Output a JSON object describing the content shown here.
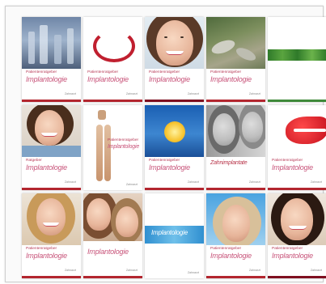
{
  "cards": [
    {
      "line1": "Patientenratgeber",
      "line2": "Implantologie",
      "line3": "",
      "logo": "Zahnarzt"
    },
    {
      "line1": "Patientenratgeber",
      "line2": "Implantologie",
      "line3": "",
      "logo": "Zahnarzt"
    },
    {
      "line1": "Patientenratgeber",
      "line2": "Implantologie",
      "line3": "",
      "logo": "Zahnarzt"
    },
    {
      "line1": "Patientenratgeber",
      "line2": "Implantologie",
      "line3": "",
      "logo": "Zahnarzt"
    },
    {
      "line1": "",
      "line2": "",
      "line3": "",
      "logo": ""
    },
    {
      "line1": "Ratgeber",
      "line2": "Implantologie",
      "line3": "",
      "logo": "Zahnarzt"
    },
    {
      "line1": "Patientenratgeber",
      "line2": "Implantologie",
      "line3": "",
      "logo": "Zahnarzt"
    },
    {
      "line1": "Patientenratgeber",
      "line2": "Implantologie",
      "line3": "",
      "logo": "Zahnarzt"
    },
    {
      "line1": "",
      "line2": "Zahnimplantate",
      "line3": "",
      "logo": "Zahnarzt"
    },
    {
      "line1": "Patientenratgeber",
      "line2": "Implantologie",
      "line3": "",
      "logo": "Zahnarzt"
    },
    {
      "line1": "Patientenratgeber",
      "line2": "Implantologie",
      "line3": "",
      "logo": "Zahnarzt"
    },
    {
      "line1": "",
      "line2": "Implantologie",
      "line3": "",
      "logo": "Zahnarzt"
    },
    {
      "line1": "",
      "line2": "Implantologie",
      "line3": "",
      "logo": "Zahnarzt"
    },
    {
      "line1": "Patientenratgeber",
      "line2": "Implantologie",
      "line3": "",
      "logo": "Zahnarzt"
    },
    {
      "line1": "Patientenratgeber",
      "line2": "Implantologie",
      "line3": "",
      "logo": "Zahnarzt"
    }
  ],
  "colors": {
    "accent_red": "#b3262f",
    "title_pink": "#c8547a",
    "subtitle_red": "#b83a57"
  }
}
